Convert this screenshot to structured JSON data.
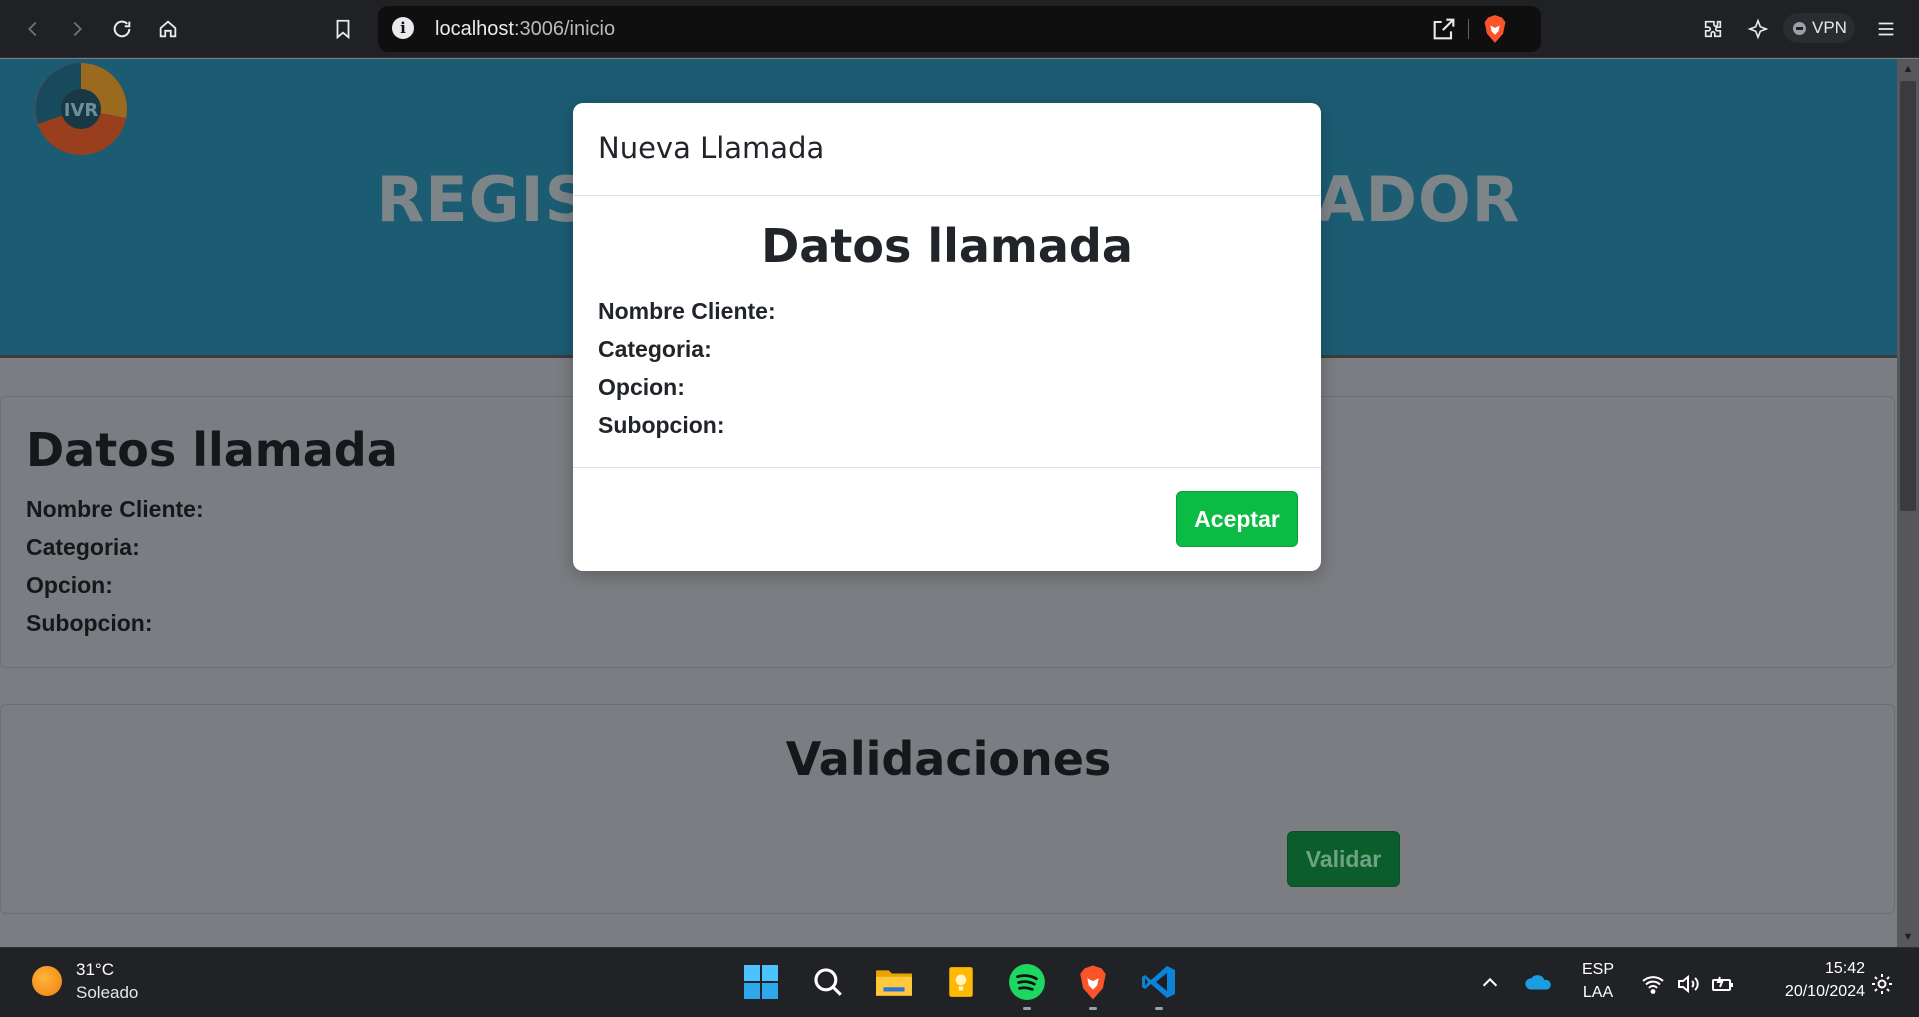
{
  "browser": {
    "url_host": "localhost",
    "url_path": ":3006/inicio",
    "vpn_label": "VPN"
  },
  "page": {
    "hero_title": "REGISTRO LLAMADA OPERADOR",
    "logo_text": "IVR",
    "datos_card": {
      "title": "Datos llamada",
      "fields": [
        "Nombre Cliente:",
        "Categoria:",
        "Opcion:",
        "Subopcion:"
      ]
    },
    "validaciones_card": {
      "title": "Validaciones",
      "button_label": "Validar"
    }
  },
  "modal": {
    "header_title": "Nueva Llamada",
    "body_title": "Datos llamada",
    "fields": [
      "Nombre Cliente:",
      "Categoria:",
      "Opcion:",
      "Subopcion:"
    ],
    "accept_label": "Aceptar"
  },
  "taskbar": {
    "weather_temp": "31°C",
    "weather_desc": "Soleado",
    "lang_top": "ESP",
    "lang_bottom": "LAA",
    "time": "15:42",
    "date": "20/10/2024"
  },
  "colors": {
    "hero_bg": "#1c5c73",
    "accept_green": "#0bbb44",
    "validate_green": "#0b5e2c"
  }
}
